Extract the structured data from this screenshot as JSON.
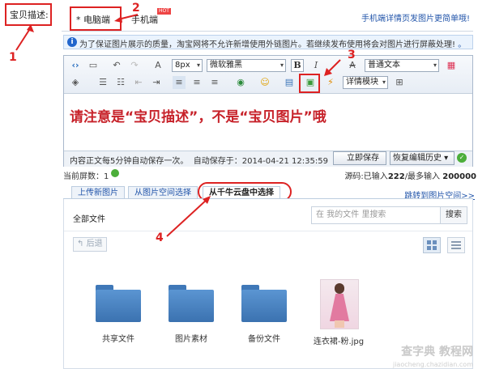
{
  "field_label": "宝贝描述:",
  "tabs": {
    "pc": "* 电脑端",
    "mobile": "手机端",
    "hot_badge": "HOT",
    "mobile_link": "手机端详情页发图片更简单哦!"
  },
  "info_bar": {
    "text": "为了保证图片展示的质量，淘宝网将不允许新增使用外链图片。若继续发布使用将会对图片进行屏蔽处理!",
    "trailing": "。"
  },
  "toolbar": {
    "font_size": "8px",
    "font_family": "微软雅黑",
    "bold": "B",
    "italic": "I",
    "strike": "A",
    "paragraph_style": "普通文本",
    "detail_module": "详情模块"
  },
  "editor_note": "请注意是“宝贝描述”，不是“宝贝图片”哦",
  "status": {
    "autosave": "内容正文每5分钟自动保存一次。",
    "saved_at_label": "自动保存于：",
    "saved_at": "2014-04-21 12:35:59",
    "save_now": "立即保存",
    "restore_history": "恢复编辑历史"
  },
  "counts": {
    "screen_label": "当前屏数：",
    "screen_value": "1",
    "source_label": "源码:已输入",
    "source_value": "222",
    "max_label": "/最多输入",
    "max_value": "200000"
  },
  "image_panel": {
    "tabs": [
      "上传新图片",
      "从图片空间选择",
      "从千牛云盘中选择"
    ],
    "jump_link": "跳转到图片空间>>",
    "all_files": "全部文件",
    "search_placeholder": "在 我的文件 里搜索",
    "search_button": "搜索",
    "back_button": "后退",
    "items": [
      {
        "label": "共享文件",
        "type": "folder"
      },
      {
        "label": "图片素材",
        "type": "folder"
      },
      {
        "label": "备份文件",
        "type": "folder"
      },
      {
        "label": "连衣裙-粉.jpg",
        "type": "image"
      }
    ]
  },
  "annotations": [
    "1",
    "2",
    "3",
    "4"
  ],
  "watermark": "查字典 教程网",
  "watermark_sub": "jiaocheng.chazidian.com",
  "colors": {
    "annotation_red": "#d22222",
    "link_blue": "#2255aa",
    "folder_blue": "#4a84c4"
  }
}
